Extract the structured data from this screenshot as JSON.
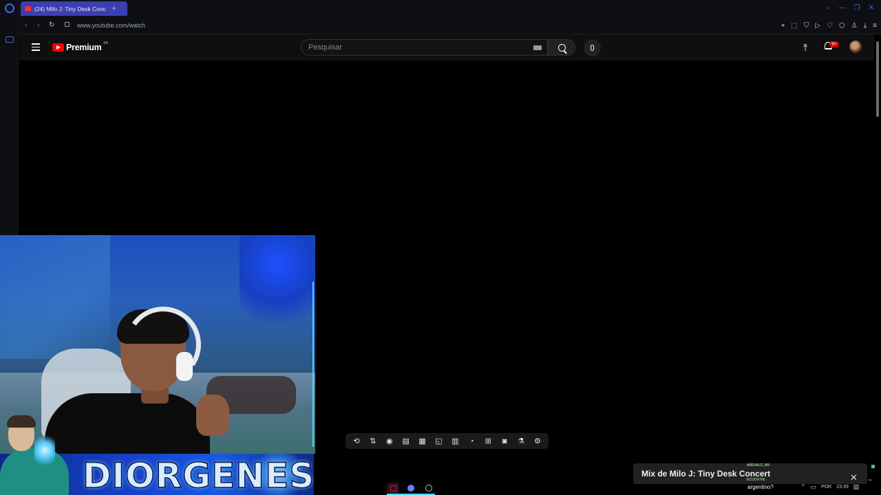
{
  "browser": {
    "tab_title": "(24) Milo J: Tiny Desk Conc",
    "new_tab": "+",
    "url": "www.youtube.com/watch"
  },
  "youtube": {
    "brand": "Premium",
    "region": "BR",
    "search_placeholder": "Pesquisar",
    "notifications_badge": "9+"
  },
  "overlay": {
    "streamer_name": "DIORGENES"
  },
  "mini_player": {
    "title": "Mix de Milo J: Tiny Desk Concert"
  },
  "chat": {
    "user1": "AREVALO_BR",
    "user2": "ECOOXTIN",
    "message": "argentino?"
  },
  "tray": {
    "lang": "POR",
    "time": "23:39"
  },
  "colors": {
    "tab_active": "#3b3fb0",
    "yt_red": "#ff0000",
    "accent_cyan": "#4ad6ff"
  }
}
